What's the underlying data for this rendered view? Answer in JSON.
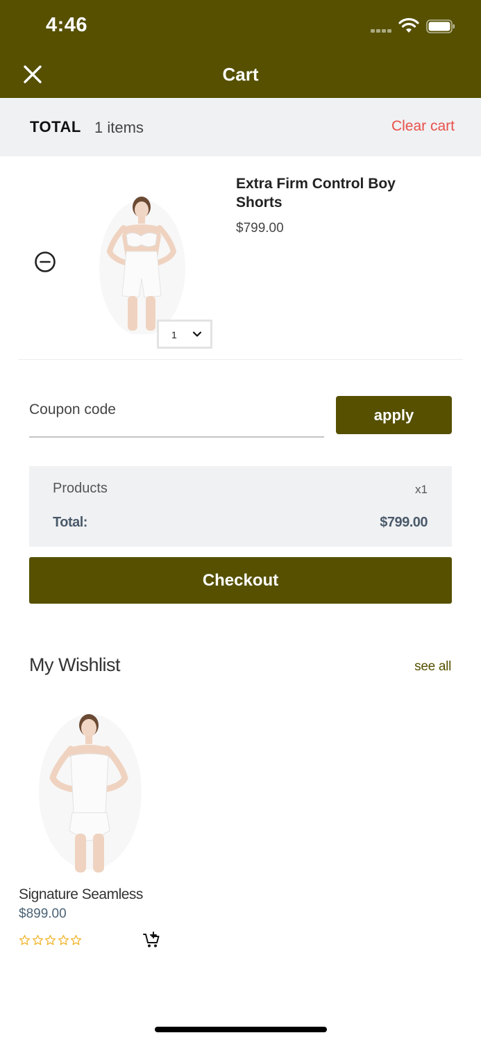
{
  "status_bar": {
    "time": "4:46"
  },
  "header": {
    "title": "Cart"
  },
  "total_bar": {
    "label": "TOTAL",
    "items_count": "1 items",
    "clear_label": "Clear cart"
  },
  "cart_item": {
    "name": "Extra Firm Control Boy Shorts",
    "price": "$799.00",
    "quantity": "1"
  },
  "coupon": {
    "placeholder": "Coupon code",
    "value": "",
    "apply_label": "apply"
  },
  "summary": {
    "products_label": "Products",
    "products_qty": "x1",
    "total_label": "Total:",
    "total_value": "$799.00"
  },
  "checkout": {
    "label": "Checkout"
  },
  "wishlist": {
    "title": "My Wishlist",
    "see_all_label": "see all",
    "items": [
      {
        "name": "Signature Seamless",
        "price": "$899.00",
        "rating": 0,
        "max_rating": 5
      }
    ]
  },
  "colors": {
    "brand": "#565000",
    "danger": "#e8504a",
    "panel": "#f0f1f3",
    "star": "#f0b429"
  },
  "icons": {
    "close": "close-icon",
    "remove": "minus-circle-icon",
    "chevron": "chevron-down-icon",
    "add_to_cart": "cart-plus-icon",
    "star": "star-outline-icon"
  }
}
